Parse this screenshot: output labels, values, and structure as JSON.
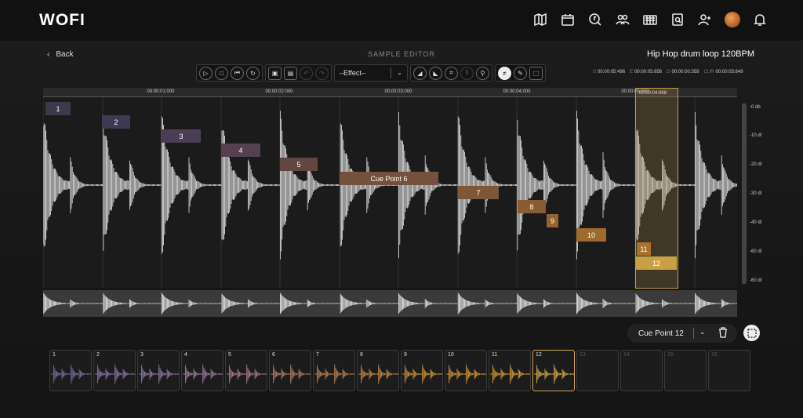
{
  "header": {
    "logo": "WOFI",
    "icons": [
      "map-icon",
      "calendar-icon",
      "music-search-icon",
      "people-icon",
      "keyboard-icon",
      "search-document-icon",
      "user-add-icon",
      "avatar",
      "bell-icon"
    ]
  },
  "editor": {
    "back_label": "Back",
    "title": "SAMPLE EDITOR",
    "file_name": "Hip Hop drum loop 120BPM",
    "effect_select": "–Effect–",
    "times": [
      {
        "prefix": "S",
        "value": "00:00:05:496"
      },
      {
        "prefix": "E",
        "value": "00:00:05:856"
      },
      {
        "prefix": "D",
        "value": "00:00:00:359"
      },
      {
        "prefix": "CUR",
        "value": "00:00:03:849"
      }
    ]
  },
  "ruler": {
    "ticks": [
      "00:00:01:000",
      "00:00:02:000",
      "00:00:03:000",
      "00:00:04:000",
      "00:00:05:000"
    ]
  },
  "cues": [
    {
      "label": "1"
    },
    {
      "label": "2"
    },
    {
      "label": "3"
    },
    {
      "label": "4"
    },
    {
      "label": "5"
    },
    {
      "label": "Cue Point 6"
    },
    {
      "label": "7"
    },
    {
      "label": "8"
    },
    {
      "label": "9"
    },
    {
      "label": "10"
    },
    {
      "label": "11"
    },
    {
      "label": "12"
    }
  ],
  "selection_time": "00:00:04:988",
  "db_scale": [
    "-0 db",
    "-10 dI",
    "-20 dI",
    "-30 dI",
    "-40 dI",
    "-60 dI",
    "-60 dI"
  ],
  "cue_selector": {
    "value": "Cue Point 12"
  },
  "pads": [
    {
      "n": "1",
      "color": "#7f6fa8",
      "filled": true
    },
    {
      "n": "2",
      "color": "#8e7ab5",
      "filled": true
    },
    {
      "n": "3",
      "color": "#9a7ab0",
      "filled": true
    },
    {
      "n": "4",
      "color": "#a37fa6",
      "filled": true
    },
    {
      "n": "5",
      "color": "#b07f8a",
      "filled": true
    },
    {
      "n": "6",
      "color": "#b8806c",
      "filled": true
    },
    {
      "n": "7",
      "color": "#c0845a",
      "filled": true
    },
    {
      "n": "8",
      "color": "#c98c4c",
      "filled": true
    },
    {
      "n": "9",
      "color": "#d6963e",
      "filled": true
    },
    {
      "n": "10",
      "color": "#dc9b3a",
      "filled": true
    },
    {
      "n": "11",
      "color": "#dfa13a",
      "filled": true
    },
    {
      "n": "12",
      "color": "#d9b24a",
      "filled": true,
      "selected": true
    },
    {
      "n": "13",
      "filled": false
    },
    {
      "n": "14",
      "filled": false
    },
    {
      "n": "15",
      "filled": false
    },
    {
      "n": "16",
      "filled": false
    }
  ],
  "colors": {
    "accent": "#c49a45",
    "cue_fill": "#8a5a45"
  }
}
